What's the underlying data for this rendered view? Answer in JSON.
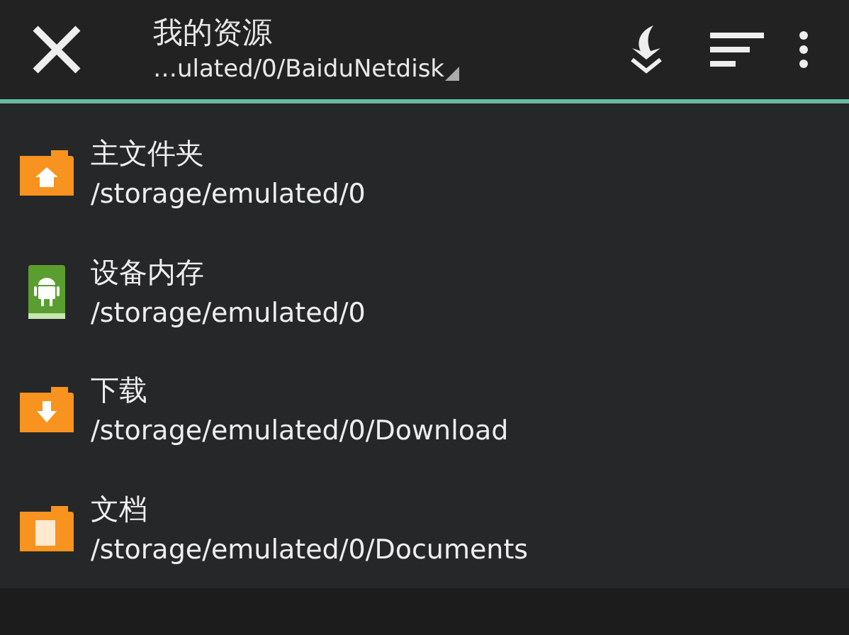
{
  "header": {
    "title": "我的资源",
    "path": "…ulated/0/BaiduNetdisk"
  },
  "items": [
    {
      "kind": "home",
      "name": "主文件夹",
      "path": "/storage/emulated/0"
    },
    {
      "kind": "android",
      "name": "设备内存",
      "path": "/storage/emulated/0"
    },
    {
      "kind": "download",
      "name": "下载",
      "path": "/storage/emulated/0/Download"
    },
    {
      "kind": "document",
      "name": "文档",
      "path": "/storage/emulated/0/Documents"
    }
  ]
}
